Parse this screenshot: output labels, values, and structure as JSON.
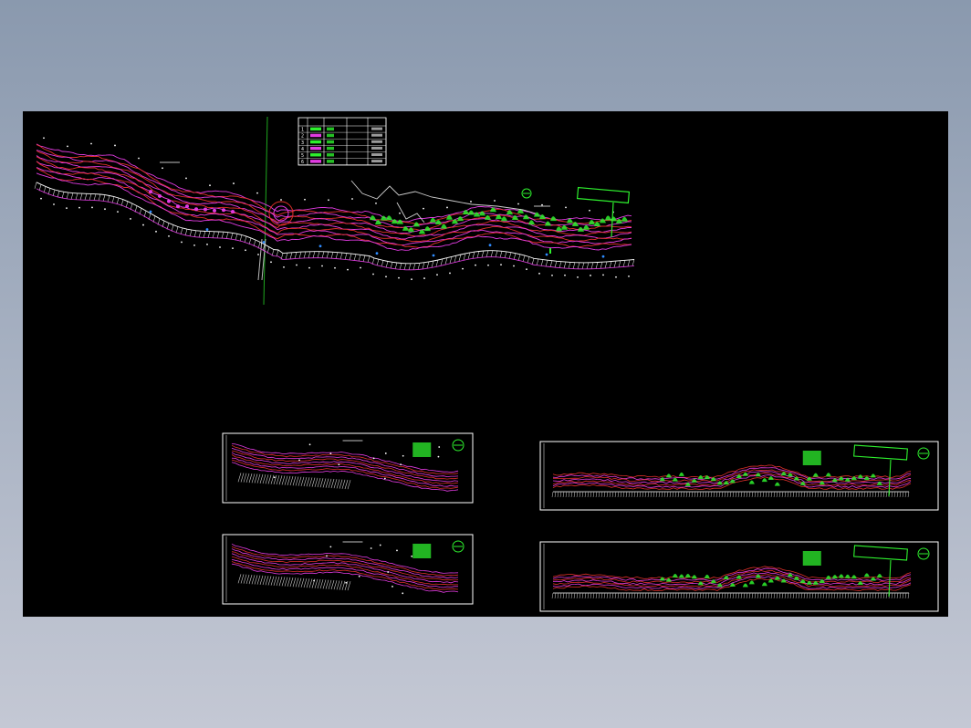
{
  "canvas": {
    "background": "#000000",
    "page_background": "#8a99ae"
  },
  "colors": {
    "contour_red": "#e0302a",
    "contour_magenta": "#e23be2",
    "vegetation_green": "#2ef02e",
    "annotation_white": "#ffffff",
    "frame_white": "#ffffff",
    "axis_green": "#1fa81f",
    "river_blue": "#2f8cff"
  },
  "drawing": {
    "main_plan": {
      "name": "main-plan-view",
      "scale_label": "N —"
    },
    "legend": {
      "rows": [
        "1",
        "2",
        "3",
        "4",
        "5",
        "6"
      ]
    },
    "sheets": [
      {
        "name": "sheet-1",
        "kind": "upper-section"
      },
      {
        "name": "sheet-2",
        "kind": "upper-section"
      },
      {
        "name": "sheet-3",
        "kind": "lower-section"
      },
      {
        "name": "sheet-4",
        "kind": "lower-section"
      }
    ]
  }
}
